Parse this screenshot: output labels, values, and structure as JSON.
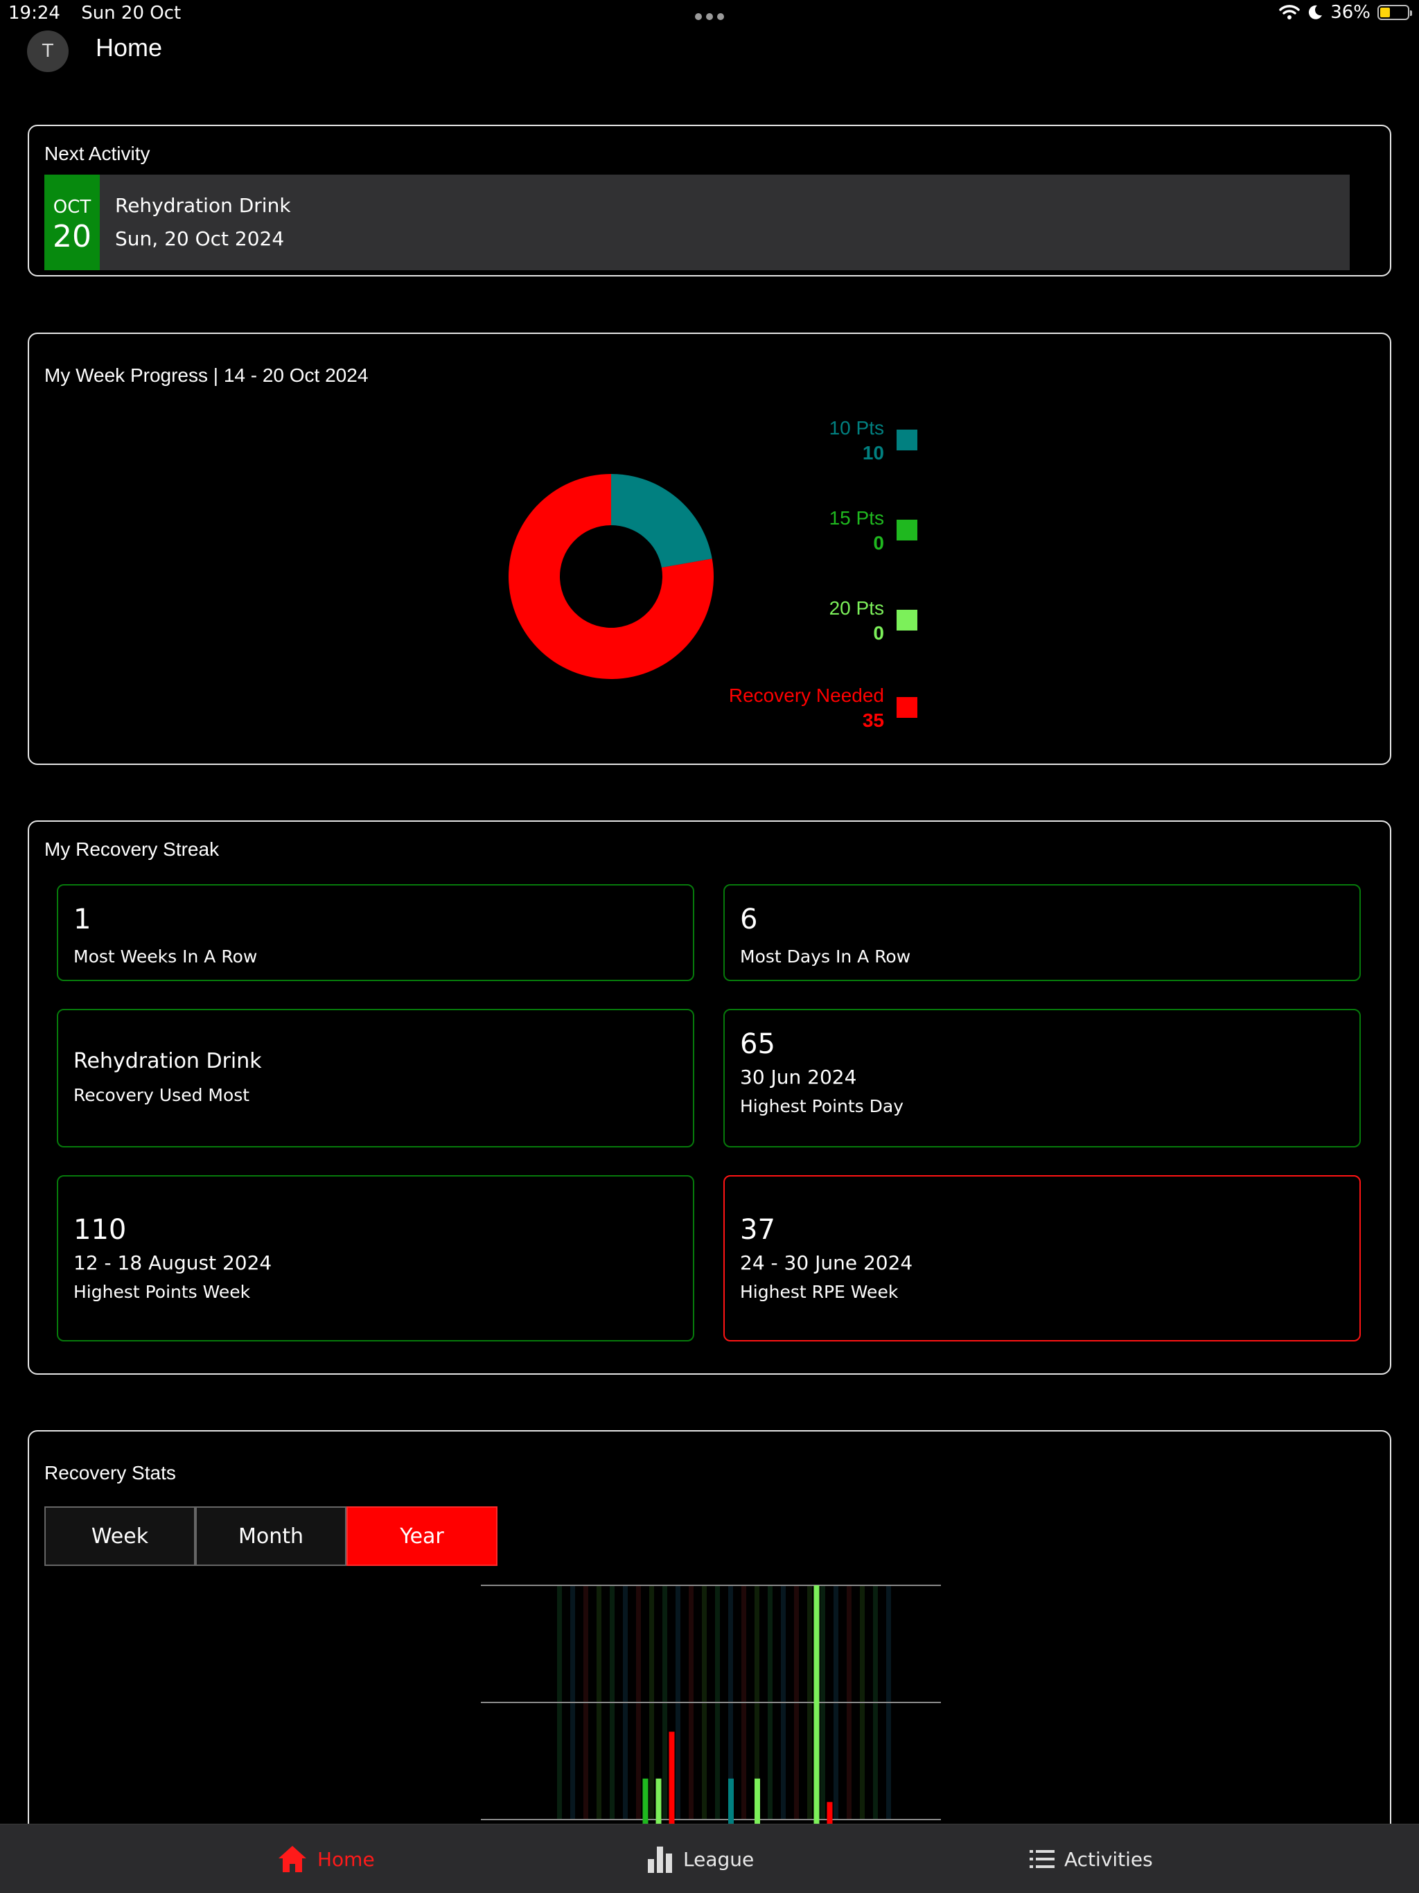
{
  "status_bar": {
    "time": "19:24",
    "date": "Sun 20 Oct",
    "battery": "36%",
    "battery_level": 0.36
  },
  "header": {
    "avatar_initial": "T",
    "title": "Home"
  },
  "next_activity": {
    "title": "Next Activity",
    "month": "OCT",
    "day": "20",
    "name": "Rehydration Drink",
    "date": "Sun, 20 Oct 2024",
    "accent": "#078a0e"
  },
  "week_progress": {
    "title": "My Week Progress | 14 - 20 Oct 2024",
    "legend": [
      {
        "label": "10 Pts",
        "value": "10",
        "color": "#018080"
      },
      {
        "label": "15 Pts",
        "value": "0",
        "color": "#1fb81f"
      },
      {
        "label": "20 Pts",
        "value": "0",
        "color": "#7cf05a"
      },
      {
        "label": "Recovery Needed",
        "value": "35",
        "color": "#ff0000"
      }
    ]
  },
  "chart_data": [
    {
      "type": "pie",
      "variant": "donut",
      "labels": [
        "10 Pts",
        "15 Pts",
        "20 Pts",
        "Recovery Needed"
      ],
      "values": [
        10,
        0,
        0,
        35
      ],
      "colors": [
        "#018080",
        "#1fb81f",
        "#7cf05a",
        "#ff0000"
      ],
      "legend_position": "right"
    },
    {
      "type": "bar",
      "grid": true,
      "ylim": [
        0,
        2
      ],
      "gridlines": [
        0,
        1,
        2
      ],
      "bars": [
        {
          "x": 13,
          "value": 0.35,
          "color": "#1fb81f"
        },
        {
          "x": 15,
          "value": 0.35,
          "color": "#7cf05a"
        },
        {
          "x": 17,
          "value": 0.75,
          "color": "#ff0000"
        },
        {
          "x": 26,
          "value": 0.35,
          "color": "#018080"
        },
        {
          "x": 30,
          "value": 0.35,
          "color": "#7cf05a"
        },
        {
          "x": 39,
          "value": 2.0,
          "color": "#7cf05a"
        },
        {
          "x": 41,
          "value": 0.15,
          "color": "#ff0000"
        }
      ]
    }
  ],
  "streak": {
    "title": "My Recovery Streak",
    "tiles": [
      {
        "value": "1",
        "label": "Most Weeks In A Row"
      },
      {
        "value": "6",
        "label": "Most Days In A Row"
      },
      {
        "value": "Rehydration Drink",
        "label": "Recovery Used Most"
      },
      {
        "value": "65",
        "sub": "30 Jun 2024",
        "label": "Highest Points Day"
      },
      {
        "value": "110",
        "sub": "12 - 18 August 2024",
        "label": "Highest Points Week"
      },
      {
        "value": "37",
        "sub": "24 - 30 June 2024",
        "label": "Highest RPE Week"
      }
    ]
  },
  "recovery_stats": {
    "title": "Recovery Stats",
    "periods": [
      "Week",
      "Month",
      "Year"
    ],
    "selected": "Year"
  },
  "tab_bar": {
    "tabs": [
      {
        "label": "Home",
        "icon": "house-icon",
        "active": true
      },
      {
        "label": "League",
        "icon": "bar-chart-icon",
        "active": false
      },
      {
        "label": "Activities",
        "icon": "list-icon",
        "active": false
      }
    ]
  }
}
